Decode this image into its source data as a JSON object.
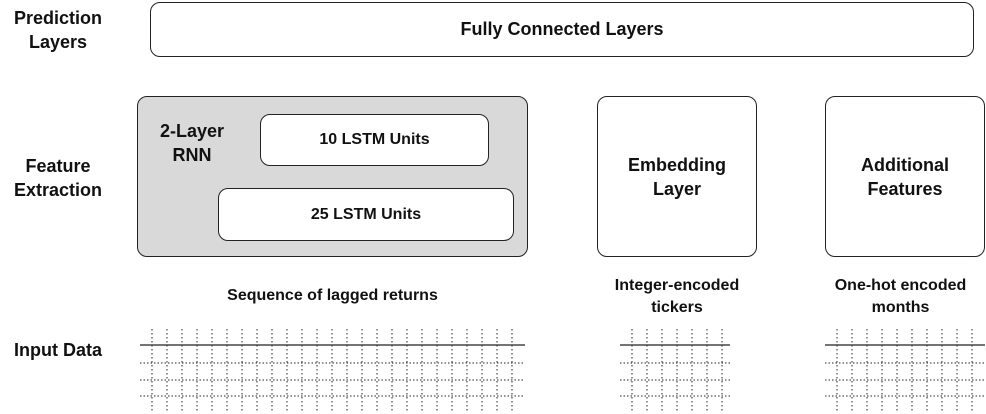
{
  "row_labels": {
    "prediction": "Prediction Layers",
    "feature": "Feature Extraction",
    "input": "Input Data"
  },
  "prediction_box": {
    "label": "Fully Connected Layers"
  },
  "rnn_group": {
    "title": "2-Layer RNN",
    "layers": [
      "10 LSTM Units",
      "25 LSTM Units"
    ]
  },
  "embedding_box": {
    "label": "Embedding Layer"
  },
  "additional_box": {
    "label": "Additional Features"
  },
  "inputs": {
    "sequence": "Sequence of lagged returns",
    "tickers": "Integer-encoded tickers",
    "months": "One-hot encoded months"
  }
}
